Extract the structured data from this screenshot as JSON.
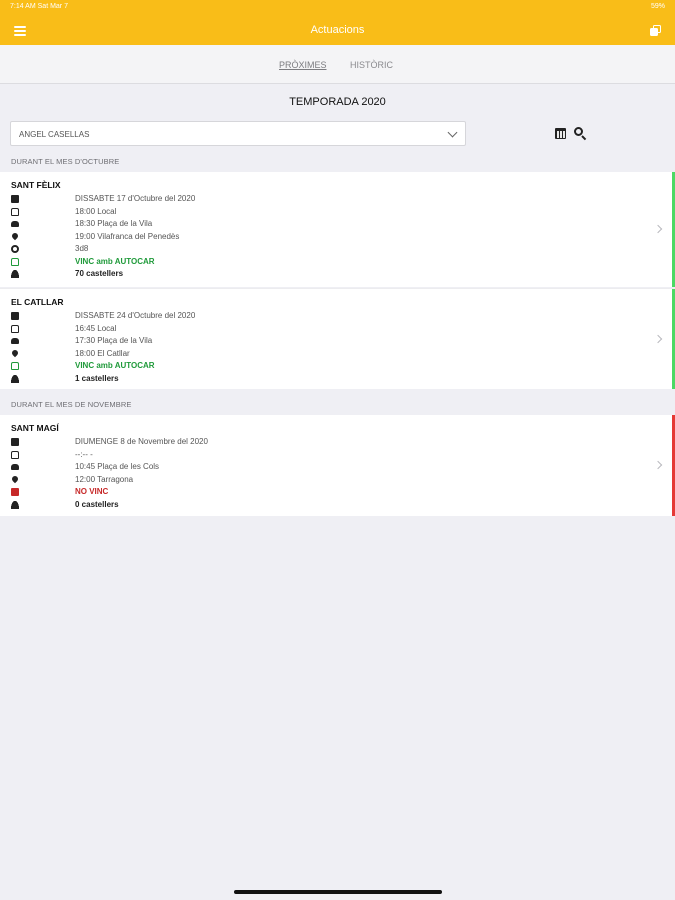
{
  "status_bar": {
    "time": "7:14 AM   Sat Mar 7",
    "battery": "59%"
  },
  "nav": {
    "title": "Actuacions"
  },
  "tabs": [
    {
      "label": "PRÒXIMES",
      "active": true
    },
    {
      "label": "HISTÒRIC",
      "active": false
    }
  ],
  "season_title": "TEMPORADA 2020",
  "person_select": {
    "value": "ANGEL CASELLAS"
  },
  "sections": [
    {
      "title": "DURANT EL MES D'OCTUBRE",
      "events": [
        {
          "name": "SANT FÈLIX",
          "status_color": "#4cd964",
          "rows": [
            {
              "icon": "calendar-icon",
              "text": "DISSABTE 17 d'Octubre del 2020",
              "style": "normal"
            },
            {
              "icon": "bus-icon",
              "text": "18:00 Local",
              "style": "normal"
            },
            {
              "icon": "car-icon",
              "text": "18:30 Plaça de la Vila",
              "style": "normal"
            },
            {
              "icon": "location-pin-icon",
              "text": "19:00 Vilafranca del Penedès",
              "style": "normal"
            },
            {
              "icon": "gear-icon",
              "text": "3d8",
              "style": "normal"
            },
            {
              "icon": "bus-icon",
              "text": "VINC amb AUTOCAR",
              "style": "green"
            },
            {
              "icon": "users-icon",
              "text": "70 castellers",
              "style": "bold"
            }
          ]
        },
        {
          "name": "EL CATLLAR",
          "status_color": "#4cd964",
          "rows": [
            {
              "icon": "calendar-icon",
              "text": "DISSABTE 24 d'Octubre del 2020",
              "style": "normal"
            },
            {
              "icon": "bus-icon",
              "text": "16:45 Local",
              "style": "normal"
            },
            {
              "icon": "car-icon",
              "text": "17:30 Plaça de la Vila",
              "style": "normal"
            },
            {
              "icon": "location-pin-icon",
              "text": "18:00 El Catllar",
              "style": "normal"
            },
            {
              "icon": "bus-icon",
              "text": "VINC amb AUTOCAR",
              "style": "green"
            },
            {
              "icon": "users-icon",
              "text": "1 castellers",
              "style": "bold"
            }
          ]
        }
      ]
    },
    {
      "title": "DURANT EL MES DE NOVEMBRE",
      "events": [
        {
          "name": "SANT MAGÍ",
          "status_color": "#e53935",
          "rows": [
            {
              "icon": "calendar-icon",
              "text": "DIUMENGE 8 de Novembre del 2020",
              "style": "normal"
            },
            {
              "icon": "bus-icon",
              "text": "--:-- -",
              "style": "normal"
            },
            {
              "icon": "car-icon",
              "text": "10:45 Plaça de les Cols",
              "style": "normal"
            },
            {
              "icon": "location-pin-icon",
              "text": "12:00 Tarragona",
              "style": "normal"
            },
            {
              "icon": "suitcase-icon",
              "text": "NO VINC",
              "style": "red"
            },
            {
              "icon": "users-icon",
              "text": "0 castellers",
              "style": "bold"
            }
          ]
        }
      ]
    }
  ],
  "colors": {
    "brand": "#f9bd18",
    "going": "#1f9a3a",
    "not_going": "#c62828"
  }
}
